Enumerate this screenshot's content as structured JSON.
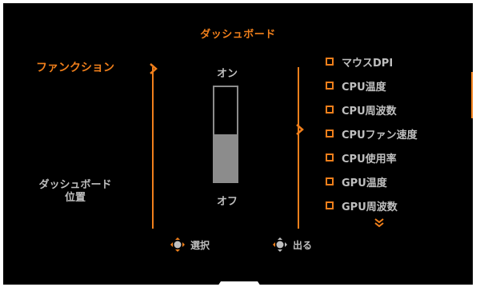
{
  "header": {
    "title": "ダッシュボード"
  },
  "left_menu": {
    "items": [
      {
        "label": "ファンクション",
        "state": "selected"
      },
      {
        "label_line1": "ダッシュボード",
        "label_line2": "位置",
        "state": "normal"
      }
    ]
  },
  "function_toggle": {
    "on_label": "オン",
    "off_label": "オフ",
    "level_percent": 50
  },
  "options": [
    {
      "label": "マウスDPI"
    },
    {
      "label": "CPU温度"
    },
    {
      "label": "CPU周波数"
    },
    {
      "label": "CPUファン速度"
    },
    {
      "label": "CPU使用率"
    },
    {
      "label": "GPU温度"
    },
    {
      "label": "GPU周波数"
    }
  ],
  "footer": {
    "select_label": "選択",
    "exit_label": "出る"
  },
  "colors": {
    "accent": "#f07f1b",
    "text": "#bfbfbf",
    "slider": "#8c8c8c",
    "background": "#000000"
  },
  "icons": {
    "select": "joystick-icon",
    "exit": "joystick-icon",
    "more": "double-chevron-down-icon"
  }
}
